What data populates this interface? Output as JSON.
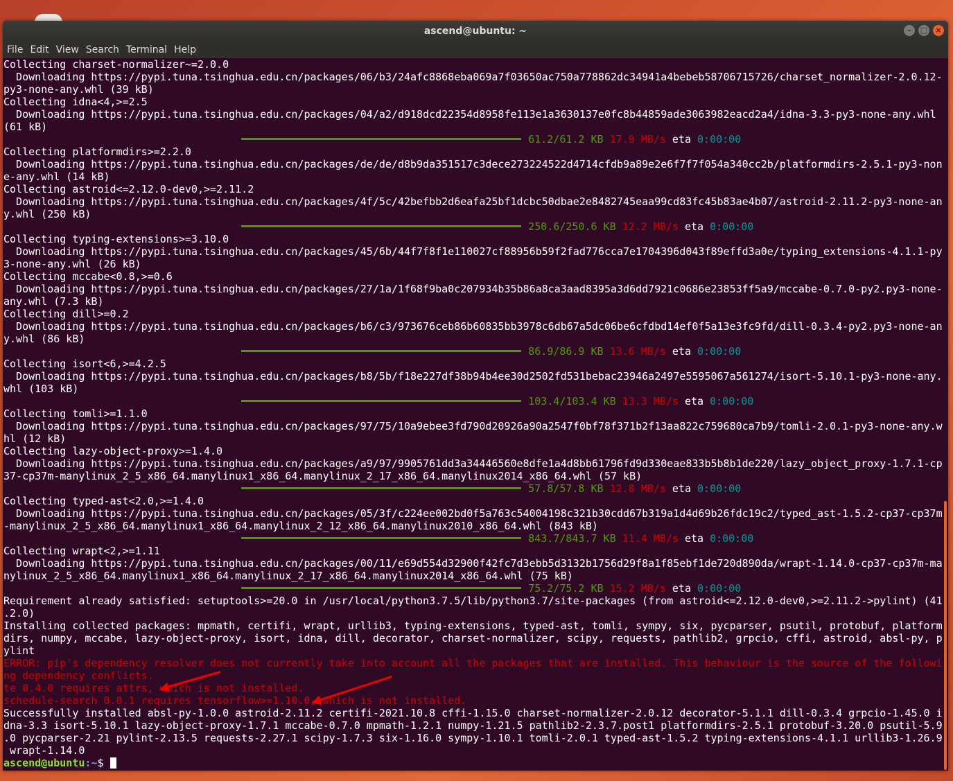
{
  "window": {
    "title": "ascend@ubuntu: ~"
  },
  "menu": [
    "File",
    "Edit",
    "View",
    "Search",
    "Terminal",
    "Help"
  ],
  "lines": [
    {
      "t": "Collecting charset-normalizer~=2.0.0"
    },
    {
      "t": "  Downloading https://pypi.tuna.tsinghua.edu.cn/packages/06/b3/24afc8868eba069a7f03650ac750a778862dc34941a4bebeb58706715726/charset_normalizer-2.0.12-"
    },
    {
      "t": "py3-none-any.whl (39 kB)"
    },
    {
      "t": "Collecting idna<4,>=2.5"
    },
    {
      "t": "  Downloading https://pypi.tuna.tsinghua.edu.cn/packages/04/a2/d918dcd22354d8958fe113e1a3630137e0fc8b44859ade3063982eacd2a4/idna-3.3-py3-none-any.whl"
    },
    {
      "t": "(61 kB)"
    },
    {
      "kind": "progress",
      "size": "61.2/61.2 KB",
      "speed": "17.9 MB/s",
      "eta": "0:00:00"
    },
    {
      "t": "Collecting platformdirs>=2.2.0"
    },
    {
      "t": "  Downloading https://pypi.tuna.tsinghua.edu.cn/packages/de/de/d8b9da351517c3dece273224522d4714cfdb9a89e2e6f7f7f054a340cc2b/platformdirs-2.5.1-py3-non"
    },
    {
      "t": "e-any.whl (14 kB)"
    },
    {
      "t": "Collecting astroid<=2.12.0-dev0,>=2.11.2"
    },
    {
      "t": "  Downloading https://pypi.tuna.tsinghua.edu.cn/packages/4f/5c/42befbb2d6eafa25bf1dcbc50dbae2e8482745eaa99cd83fc45b83ae4b07/astroid-2.11.2-py3-none-an"
    },
    {
      "t": "y.whl (250 kB)"
    },
    {
      "kind": "progress",
      "size": "250.6/250.6 KB",
      "speed": "12.2 MB/s",
      "eta": "0:00:00"
    },
    {
      "t": "Collecting typing-extensions>=3.10.0"
    },
    {
      "t": "  Downloading https://pypi.tuna.tsinghua.edu.cn/packages/45/6b/44f7f8f1e110027cf88956b59f2fad776cca7e1704396d043f89effd3a0e/typing_extensions-4.1.1-py"
    },
    {
      "t": "3-none-any.whl (26 kB)"
    },
    {
      "t": "Collecting mccabe<0.8,>=0.6"
    },
    {
      "t": "  Downloading https://pypi.tuna.tsinghua.edu.cn/packages/27/1a/1f68f9ba0c207934b35b86a8ca3aad8395a3d6dd7921c0686e23853ff5a9/mccabe-0.7.0-py2.py3-none-"
    },
    {
      "t": "any.whl (7.3 kB)"
    },
    {
      "t": "Collecting dill>=0.2"
    },
    {
      "t": "  Downloading https://pypi.tuna.tsinghua.edu.cn/packages/b6/c3/973676ceb86b60835bb3978c6db67a5dc06be6cfdbd14ef0f5a13e3fc9fd/dill-0.3.4-py2.py3-none-an"
    },
    {
      "t": "y.whl (86 kB)"
    },
    {
      "kind": "progress",
      "size": "86.9/86.9 KB",
      "speed": "13.6 MB/s",
      "eta": "0:00:00"
    },
    {
      "t": "Collecting isort<6,>=4.2.5"
    },
    {
      "t": "  Downloading https://pypi.tuna.tsinghua.edu.cn/packages/b8/5b/f18e227df38b94b4ee30d2502fd531bebac23946a2497e5595067a561274/isort-5.10.1-py3-none-any."
    },
    {
      "t": "whl (103 kB)"
    },
    {
      "kind": "progress",
      "size": "103.4/103.4 KB",
      "speed": "13.3 MB/s",
      "eta": "0:00:00"
    },
    {
      "t": "Collecting tomli>=1.1.0"
    },
    {
      "t": "  Downloading https://pypi.tuna.tsinghua.edu.cn/packages/97/75/10a9ebee3fd790d20926a90a2547f0bf78f371b2f13aa822c759680ca7b9/tomli-2.0.1-py3-none-any.w"
    },
    {
      "t": "hl (12 kB)"
    },
    {
      "t": "Collecting lazy-object-proxy>=1.4.0"
    },
    {
      "t": "  Downloading https://pypi.tuna.tsinghua.edu.cn/packages/a9/97/9905761dd3a34446560e8dfe1a4d8bb61796fd9d330eae833b5b8b1de220/lazy_object_proxy-1.7.1-cp"
    },
    {
      "t": "37-cp37m-manylinux_2_5_x86_64.manylinux1_x86_64.manylinux_2_17_x86_64.manylinux2014_x86_64.whl (57 kB)"
    },
    {
      "kind": "progress",
      "size": "57.8/57.8 KB",
      "speed": "12.8 MB/s",
      "eta": "0:00:00"
    },
    {
      "t": "Collecting typed-ast<2.0,>=1.4.0"
    },
    {
      "t": "  Downloading https://pypi.tuna.tsinghua.edu.cn/packages/05/3f/c224ee002bd0f5a763c54004198c321b30cdd67b319a1d4d69b26fdc19c2/typed_ast-1.5.2-cp37-cp37m"
    },
    {
      "t": "-manylinux_2_5_x86_64.manylinux1_x86_64.manylinux_2_12_x86_64.manylinux2010_x86_64.whl (843 kB)"
    },
    {
      "kind": "progress",
      "size": "843.7/843.7 KB",
      "speed": "11.4 MB/s",
      "eta": "0:00:00"
    },
    {
      "t": "Collecting wrapt<2,>=1.11"
    },
    {
      "t": "  Downloading https://pypi.tuna.tsinghua.edu.cn/packages/00/11/e69d554d32900f42fc7d3ebb5d3132b1756d29f8a1f85ebf1de720d890da/wrapt-1.14.0-cp37-cp37m-ma"
    },
    {
      "t": "nylinux_2_5_x86_64.manylinux1_x86_64.manylinux_2_17_x86_64.manylinux2014_x86_64.whl (75 kB)"
    },
    {
      "kind": "progress",
      "size": "75.2/75.2 KB",
      "speed": "15.2 MB/s",
      "eta": "0:00:00"
    },
    {
      "t": "Requirement already satisfied: setuptools>=20.0 in /usr/local/python3.7.5/lib/python3.7/site-packages (from astroid<=2.12.0-dev0,>=2.11.2->pylint) (41"
    },
    {
      "t": ".2.0)"
    },
    {
      "t": "Installing collected packages: mpmath, certifi, wrapt, urllib3, typing-extensions, typed-ast, tomli, sympy, six, pycparser, psutil, protobuf, platform"
    },
    {
      "t": "dirs, numpy, mccabe, lazy-object-proxy, isort, idna, dill, decorator, charset-normalizer, scipy, requests, pathlib2, grpcio, cffi, astroid, absl-py, p"
    },
    {
      "t": "ylint"
    },
    {
      "t": "ERROR: pip's dependency resolver does not currently take into account all the packages that are installed. This behaviour is the source of the followi",
      "kind": "error"
    },
    {
      "t": "ng dependency conflicts.",
      "kind": "error"
    },
    {
      "t": "te 0.4.0 requires attrs, which is not installed.",
      "kind": "error"
    },
    {
      "t": "schedule-search 0.0.1 requires tensorflow>=1.10.0, which is not installed.",
      "kind": "error"
    },
    {
      "t": "Successfully installed absl-py-1.0.0 astroid-2.11.2 certifi-2021.10.8 cffi-1.15.0 charset-normalizer-2.0.12 decorator-5.1.1 dill-0.3.4 grpcio-1.45.0 i"
    },
    {
      "t": "dna-3.3 isort-5.10.1 lazy-object-proxy-1.7.1 mccabe-0.7.0 mpmath-1.2.1 numpy-1.21.5 pathlib2-2.3.7.post1 platformdirs-2.5.1 protobuf-3.20.0 psutil-5.9"
    },
    {
      "t": ".0 pycparser-2.21 pylint-2.13.5 requests-2.27.1 scipy-1.7.3 six-1.16.0 sympy-1.10.1 tomli-2.0.1 typed-ast-1.5.2 typing-extensions-4.1.1 urllib3-1.26.9"
    },
    {
      "t": " wrapt-1.14.0"
    }
  ],
  "prompt": {
    "user": "ascend@ubuntu",
    "path": ":~",
    "symbol": "$ "
  },
  "eta_label": "eta"
}
